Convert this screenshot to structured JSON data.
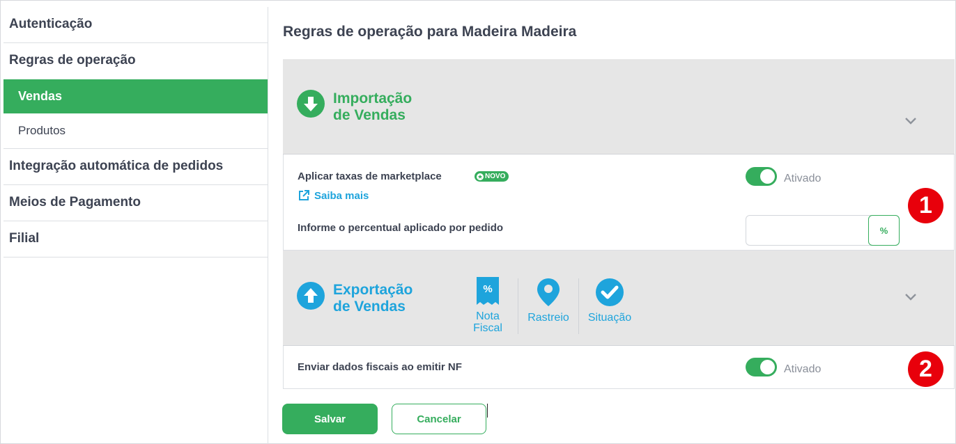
{
  "sidebar": {
    "items": [
      {
        "label": "Autenticação"
      },
      {
        "label": "Regras de operação"
      },
      {
        "label": "Integração automática de pedidos"
      },
      {
        "label": "Meios de Pagamento"
      },
      {
        "label": "Filial"
      }
    ],
    "subitems": [
      {
        "label": "Vendas",
        "active": true
      },
      {
        "label": "Produtos",
        "active": false
      }
    ]
  },
  "page": {
    "title": "Regras de operação para Madeira Madeira"
  },
  "import_section": {
    "title_line1": "Importação",
    "title_line2": "de Vendas",
    "icon": "arrow-down-circle-icon",
    "color": "#35ad5d",
    "marketplace_fee": {
      "label": "Aplicar taxas de marketplace",
      "badge": "NOVO",
      "toggle_state": "Ativado",
      "link": "Saiba mais",
      "percent_label": "Informe o percentual aplicado por pedido",
      "percent_value": "",
      "percent_symbol": "%"
    },
    "marker": "1"
  },
  "export_section": {
    "title_line1": "Exportação",
    "title_line2": "de Vendas",
    "icon": "arrow-up-circle-icon",
    "color": "#1ea4dc",
    "features": [
      {
        "label_line1": "Nota",
        "label_line2": "Fiscal",
        "icon": "receipt-percent-icon"
      },
      {
        "label_line1": "Rastreio",
        "label_line2": "",
        "icon": "location-pin-icon"
      },
      {
        "label_line1": "Situação",
        "label_line2": "",
        "icon": "check-circle-icon"
      }
    ],
    "fiscal": {
      "label": "Enviar dados fiscais ao emitir NF",
      "toggle_state": "Ativado"
    },
    "marker": "2"
  },
  "actions": {
    "save_label": "Salvar",
    "cancel_label": "Cancelar"
  }
}
